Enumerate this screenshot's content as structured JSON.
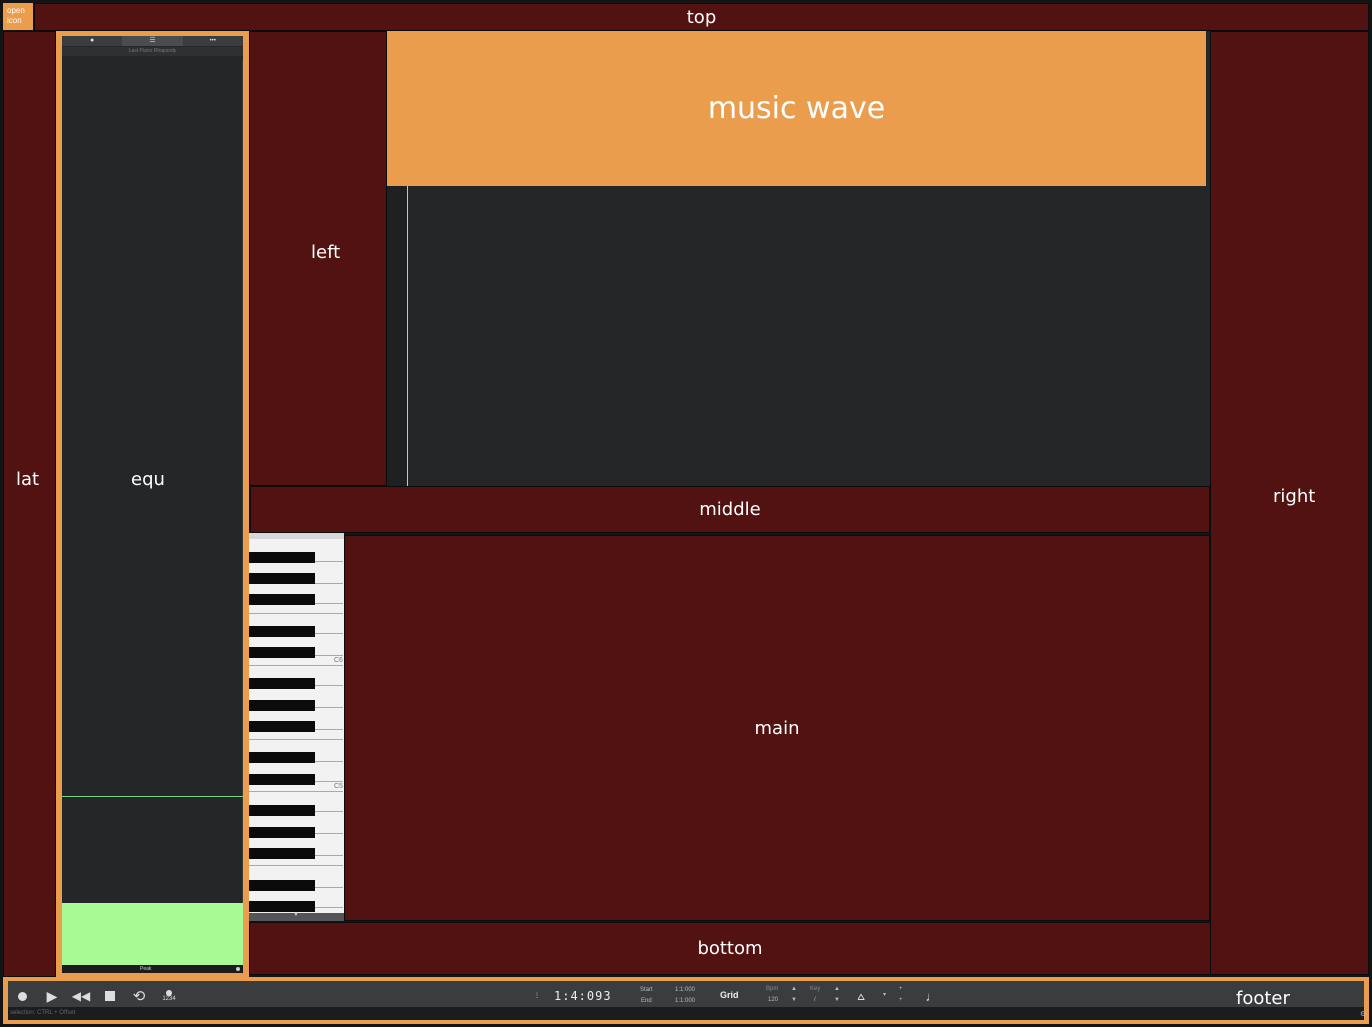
{
  "open_icon": {
    "line1": "open",
    "line2": "icon"
  },
  "regions": {
    "top": "top",
    "lat": "lat",
    "equ": "equ",
    "left": "left",
    "music_wave": "music wave",
    "middle": "middle",
    "main": "main",
    "right": "right",
    "bottom": "bottom",
    "footer": "footer"
  },
  "equ_panel": {
    "tabs": [
      "●",
      "☰",
      "•••"
    ],
    "subtitle": "Last Piano Rhapsody",
    "peak_label": "Peak"
  },
  "piano": {
    "labels": [
      "C6",
      "C5"
    ]
  },
  "transport": {
    "position": "1:4:093",
    "start_label": "Start",
    "start_value": "1:1:000",
    "end_label": "End",
    "end_value": "1:1:000",
    "grid_label": "Grid",
    "bpm_label": "Bpm",
    "bpm_value": "120",
    "key_label": "Key",
    "key_value": "/",
    "status_text": "selection: CTRL + Offset"
  },
  "colors": {
    "region_fill": "#521212",
    "accent_orange": "#ea9d4d",
    "panel_dark": "#242628",
    "level_green": "#a8fb94"
  }
}
